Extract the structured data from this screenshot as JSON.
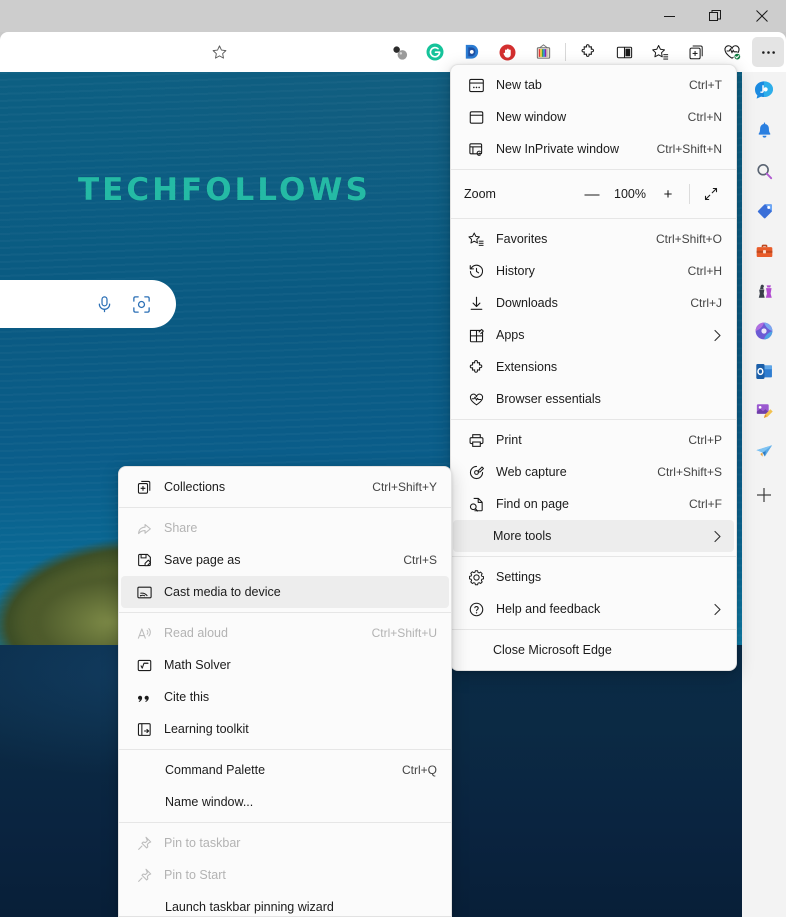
{
  "window": {
    "controls": [
      {
        "name": "minimize",
        "glyph": "—"
      },
      {
        "name": "restore",
        "glyph": "❐"
      },
      {
        "name": "close",
        "glyph": "✕"
      }
    ]
  },
  "toolbar": {
    "extensions": [
      {
        "name": "favorites-star-icon",
        "title": "Add this page to favorites"
      },
      {
        "name": "spheres-extension-icon",
        "title": "Extension"
      },
      {
        "name": "grammarly-extension-icon",
        "title": "Grammarly"
      },
      {
        "name": "blue-d-extension-icon",
        "title": "Extension"
      },
      {
        "name": "adblock-extension-icon",
        "title": "Ad blocker"
      },
      {
        "name": "tv-extension-icon",
        "title": "Extension"
      }
    ],
    "actions": [
      {
        "name": "extensions-icon",
        "title": "Extensions"
      },
      {
        "name": "split-screen-icon",
        "title": "Split screen"
      },
      {
        "name": "favorites-icon",
        "title": "Favorites"
      },
      {
        "name": "collections-icon",
        "title": "Collections"
      },
      {
        "name": "browser-essentials-icon",
        "title": "Browser essentials"
      },
      {
        "name": "settings-and-more-icon",
        "title": "Settings and more",
        "active": true,
        "glyph": "⋯"
      }
    ]
  },
  "page": {
    "brand": "TECHFOLLOWS",
    "search": {
      "placeholder": "",
      "value": "",
      "mic_icon": "microphone-icon",
      "lens_icon": "visual-search-icon"
    }
  },
  "sidebar": {
    "items": [
      {
        "name": "copilot-icon",
        "label": "Copilot"
      },
      {
        "name": "notifications-bell-icon",
        "label": "Notifications"
      },
      {
        "name": "search-icon",
        "label": "Search"
      },
      {
        "name": "shopping-tag-icon",
        "label": "Shopping"
      },
      {
        "name": "tools-briefcase-icon",
        "label": "Tools"
      },
      {
        "name": "games-icon",
        "label": "Games"
      },
      {
        "name": "microsoft365-icon",
        "label": "Microsoft 365"
      },
      {
        "name": "outlook-icon",
        "label": "Outlook"
      },
      {
        "name": "image-editor-icon",
        "label": "Image editor"
      },
      {
        "name": "drop-icon",
        "label": "Drop"
      },
      {
        "name": "customize-add-icon",
        "label": "Customize",
        "glyph": "+"
      }
    ]
  },
  "main_menu": {
    "groups": [
      {
        "items": [
          {
            "label": "New tab",
            "accel": "Ctrl+T",
            "icon": "new-tab-icon",
            "name": "menu-item-new-tab"
          },
          {
            "label": "New window",
            "accel": "Ctrl+N",
            "icon": "new-window-icon",
            "name": "menu-item-new-window"
          },
          {
            "label": "New InPrivate window",
            "accel": "Ctrl+Shift+N",
            "icon": "inprivate-window-icon",
            "name": "menu-item-new-inprivate-window"
          }
        ]
      },
      {
        "zoom_row": {
          "label": "Zoom",
          "value": "100%",
          "minus": "—",
          "plus": "+",
          "fullscreen_icon": "fullscreen-icon",
          "name": "menu-row-zoom"
        }
      },
      {
        "items": [
          {
            "label": "Favorites",
            "accel": "Ctrl+Shift+O",
            "icon": "favorites-star-list-icon",
            "name": "menu-item-favorites"
          },
          {
            "label": "History",
            "accel": "Ctrl+H",
            "icon": "history-clock-icon",
            "name": "menu-item-history"
          },
          {
            "label": "Downloads",
            "accel": "Ctrl+J",
            "icon": "downloads-arrow-icon",
            "name": "menu-item-downloads"
          },
          {
            "label": "Apps",
            "accel": "",
            "submenu": true,
            "icon": "apps-grid-icon",
            "name": "menu-item-apps"
          },
          {
            "label": "Extensions",
            "accel": "",
            "icon": "extensions-puzzle-icon",
            "name": "menu-item-extensions"
          },
          {
            "label": "Browser essentials",
            "accel": "",
            "icon": "browser-essentials-heart-icon",
            "name": "menu-item-browser-essentials"
          }
        ]
      },
      {
        "items": [
          {
            "label": "Print",
            "accel": "Ctrl+P",
            "icon": "printer-icon",
            "name": "menu-item-print"
          },
          {
            "label": "Web capture",
            "accel": "Ctrl+Shift+S",
            "icon": "web-capture-icon",
            "name": "menu-item-web-capture"
          },
          {
            "label": "Find on page",
            "accel": "Ctrl+F",
            "icon": "find-on-page-icon",
            "name": "menu-item-find-on-page"
          },
          {
            "label": "More tools",
            "accel": "",
            "submenu": true,
            "icon": "",
            "selected": true,
            "name": "menu-item-more-tools"
          }
        ]
      },
      {
        "items": [
          {
            "label": "Settings",
            "accel": "",
            "icon": "settings-gear-icon",
            "name": "menu-item-settings"
          },
          {
            "label": "Help and feedback",
            "accel": "",
            "submenu": true,
            "icon": "help-question-icon",
            "name": "menu-item-help-and-feedback"
          }
        ]
      },
      {
        "items": [
          {
            "label": "Close Microsoft Edge",
            "accel": "",
            "icon": "",
            "name": "menu-item-close-edge"
          }
        ]
      }
    ]
  },
  "sub_menu": {
    "groups": [
      {
        "items": [
          {
            "label": "Collections",
            "accel": "Ctrl+Shift+Y",
            "icon": "collections-plus-icon",
            "name": "submenu-item-collections"
          }
        ]
      },
      {
        "items": [
          {
            "label": "Share",
            "accel": "",
            "icon": "share-icon",
            "disabled": true,
            "name": "submenu-item-share"
          },
          {
            "label": "Save page as",
            "accel": "Ctrl+S",
            "icon": "save-page-icon",
            "name": "submenu-item-save-page-as"
          },
          {
            "label": "Cast media to device",
            "accel": "",
            "icon": "cast-icon",
            "selected": true,
            "name": "submenu-item-cast-media"
          }
        ]
      },
      {
        "items": [
          {
            "label": "Read aloud",
            "accel": "Ctrl+Shift+U",
            "icon": "read-aloud-icon",
            "disabled": true,
            "name": "submenu-item-read-aloud"
          },
          {
            "label": "Math Solver",
            "accel": "",
            "icon": "math-solver-icon",
            "name": "submenu-item-math-solver"
          },
          {
            "label": "Cite this",
            "accel": "",
            "icon": "cite-this-icon",
            "name": "submenu-item-cite-this"
          },
          {
            "label": "Learning toolkit",
            "accel": "",
            "icon": "learning-toolkit-icon",
            "name": "submenu-item-learning-toolkit"
          }
        ]
      },
      {
        "items": [
          {
            "label": "Command Palette",
            "accel": "Ctrl+Q",
            "icon": "",
            "name": "submenu-item-command-palette"
          },
          {
            "label": "Name window...",
            "accel": "",
            "icon": "",
            "name": "submenu-item-name-window"
          }
        ]
      },
      {
        "items": [
          {
            "label": "Pin to taskbar",
            "accel": "",
            "icon": "pin-icon",
            "disabled": true,
            "name": "submenu-item-pin-to-taskbar"
          },
          {
            "label": "Pin to Start",
            "accel": "",
            "icon": "pin-icon",
            "disabled": true,
            "name": "submenu-item-pin-to-start"
          },
          {
            "label": "Launch taskbar pinning wizard",
            "accel": "",
            "icon": "",
            "name": "submenu-item-launch-taskbar-pinning-wizard"
          }
        ]
      }
    ]
  }
}
